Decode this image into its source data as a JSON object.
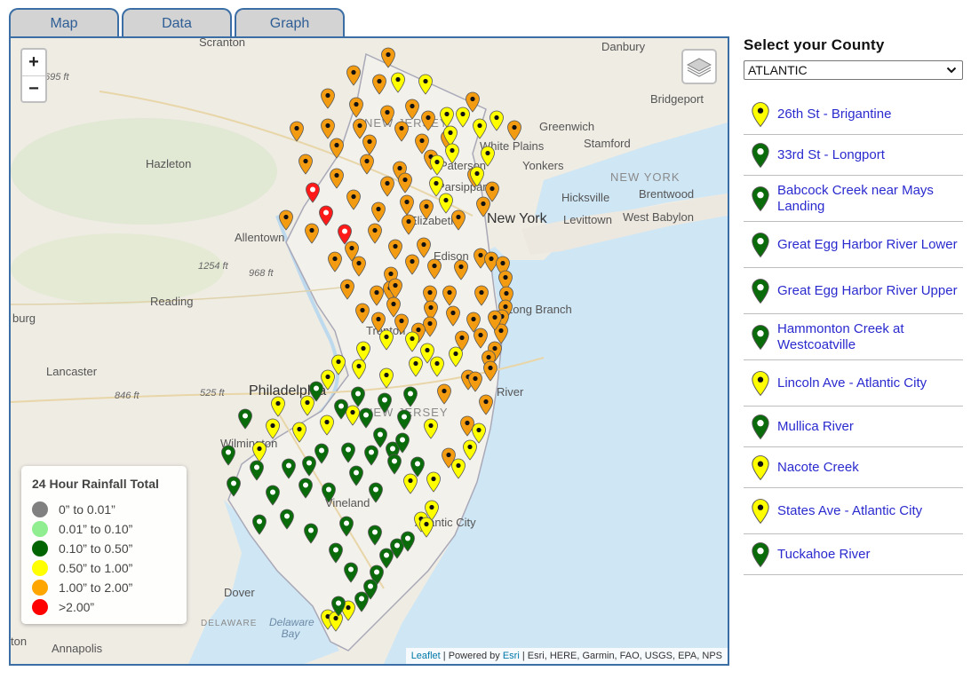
{
  "tabs": [
    {
      "label": "Map"
    },
    {
      "label": "Data"
    },
    {
      "label": "Graph"
    }
  ],
  "map": {
    "zoom_in": "+",
    "zoom_out": "−",
    "labels": {
      "scranton": "Scranton",
      "danbury": "Danbury",
      "bridgeport": "Bridgeport",
      "greenwich": "Greenwich",
      "stamford": "Stamford",
      "white_plains": "White Plains",
      "yonkers": "Yonkers",
      "hazleton": "Hazleton",
      "paterson": "Paterson",
      "parsippany": "Parsippany",
      "new_york_state": "NEW YORK",
      "hicksville": "Hicksville",
      "brentwood": "Brentwood",
      "elizabeth": "Elizabeth",
      "new_york": "New York",
      "levittown": "Levittown",
      "west_babylon": "West Babylon",
      "allentown": "Allentown",
      "edison": "Edison",
      "ft1254": "1254 ft",
      "ft968": "968 ft",
      "ft695": "695 ft",
      "reading": "Reading",
      "long_branch": "Long Branch",
      "burg": "burg",
      "trenton": "Trenton",
      "lancaster": "Lancaster",
      "philadelphia": "Philadelphia",
      "ft525": "525 ft",
      "ft846": "846 ft",
      "toms_river": "River",
      "new_jersey_n": "NEW JERSEY",
      "new_jersey_s": "NEW JERSEY",
      "wilmington": "Wilmington",
      "vineland": "Vineland",
      "atlantic_city": "Atlantic City",
      "dover": "Dover",
      "delaware_state": "DELAWARE",
      "delaware_bay": "Delaware Bay",
      "annapolis": "Annapolis",
      "ton": "ton"
    },
    "attribution": {
      "leaflet": "Leaflet",
      "powered": " | Powered by ",
      "esri": "Esri",
      "rest": " | Esri, HERE, Garmin, FAO, USGS, EPA, NPS"
    },
    "pin_colors": {
      "orange": "#f39c12",
      "yellow": "#ffff00",
      "green": "#0a6b0a",
      "red": "#ff1a1a"
    }
  },
  "legend": {
    "title": "24 Hour Rainfall Total",
    "items": [
      {
        "label": "0” to 0.01”",
        "color": "#808080"
      },
      {
        "label": "0.01” to 0.10”",
        "color": "#90ee90"
      },
      {
        "label": "0.10” to 0.50”",
        "color": "#006400"
      },
      {
        "label": "0.50” to 1.00”",
        "color": "#ffff00"
      },
      {
        "label": "1.00” to 2.00”",
        "color": "#ffa500"
      },
      {
        "label": ">2.00”",
        "color": "#ff0000"
      }
    ]
  },
  "sidebar": {
    "heading": "Select your County",
    "county": "ATLANTIC",
    "stations": [
      {
        "name": "26th St - Brigantine",
        "color": "yellow"
      },
      {
        "name": "33rd St - Longport",
        "color": "green"
      },
      {
        "name": "Babcock Creek near Mays Landing",
        "color": "green"
      },
      {
        "name": "Great Egg Harbor River Lower",
        "color": "green"
      },
      {
        "name": "Great Egg Harbor River Upper",
        "color": "green"
      },
      {
        "name": "Hammonton Creek at Westcoatville",
        "color": "green"
      },
      {
        "name": "Lincoln Ave - Atlantic City",
        "color": "yellow"
      },
      {
        "name": "Mullica River",
        "color": "green"
      },
      {
        "name": "Nacote Creek",
        "color": "yellow"
      },
      {
        "name": "States Ave - Atlantic City",
        "color": "yellow"
      },
      {
        "name": "Tuckahoe River",
        "color": "green"
      }
    ]
  }
}
